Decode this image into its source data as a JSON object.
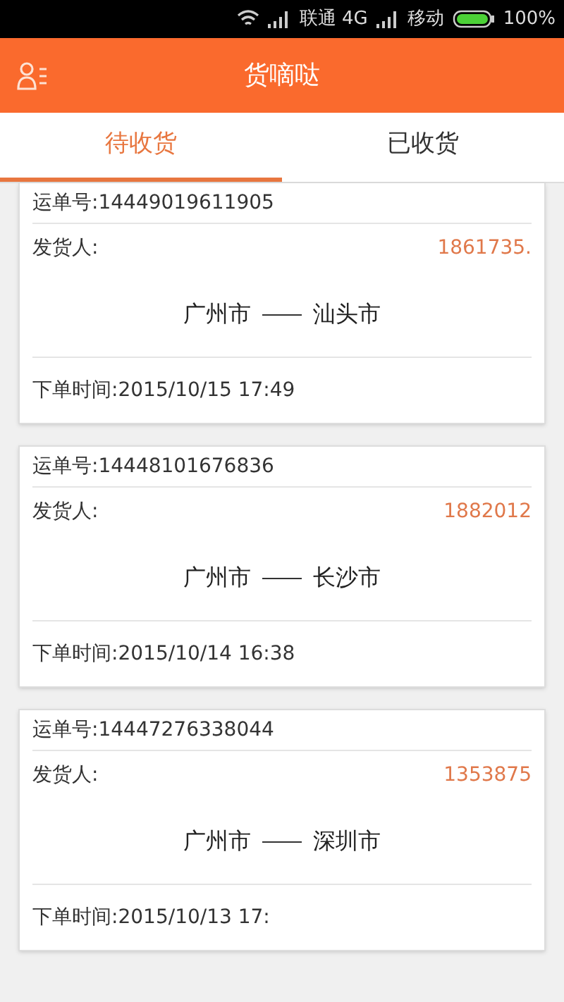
{
  "status_bar": {
    "carrier_1": "联通 4G",
    "carrier_2": "移动",
    "battery": "100%"
  },
  "header": {
    "title": "货嘀哒"
  },
  "tabs": [
    {
      "label": "待收货",
      "selected": true
    },
    {
      "label": "已收货",
      "selected": false
    }
  ],
  "orders": [
    {
      "waybill": "运单号:14449019611905",
      "sender": "发货人:",
      "phone": "1861735.",
      "from": "广州市",
      "to": "汕头市",
      "time": "下单时间:2015/10/15 17:49"
    },
    {
      "waybill": "运单号:14448101676836",
      "sender": "发货人:",
      "phone": "1882012",
      "from": "广州市",
      "to": "长沙市",
      "time": "下单时间:2015/10/14 16:38"
    },
    {
      "waybill": "运单号:14447276338044",
      "sender": "发货人:",
      "phone": "1353875",
      "from": "广州市",
      "to": "深圳市",
      "time": "下单时间:2015/10/13 17:"
    }
  ]
}
